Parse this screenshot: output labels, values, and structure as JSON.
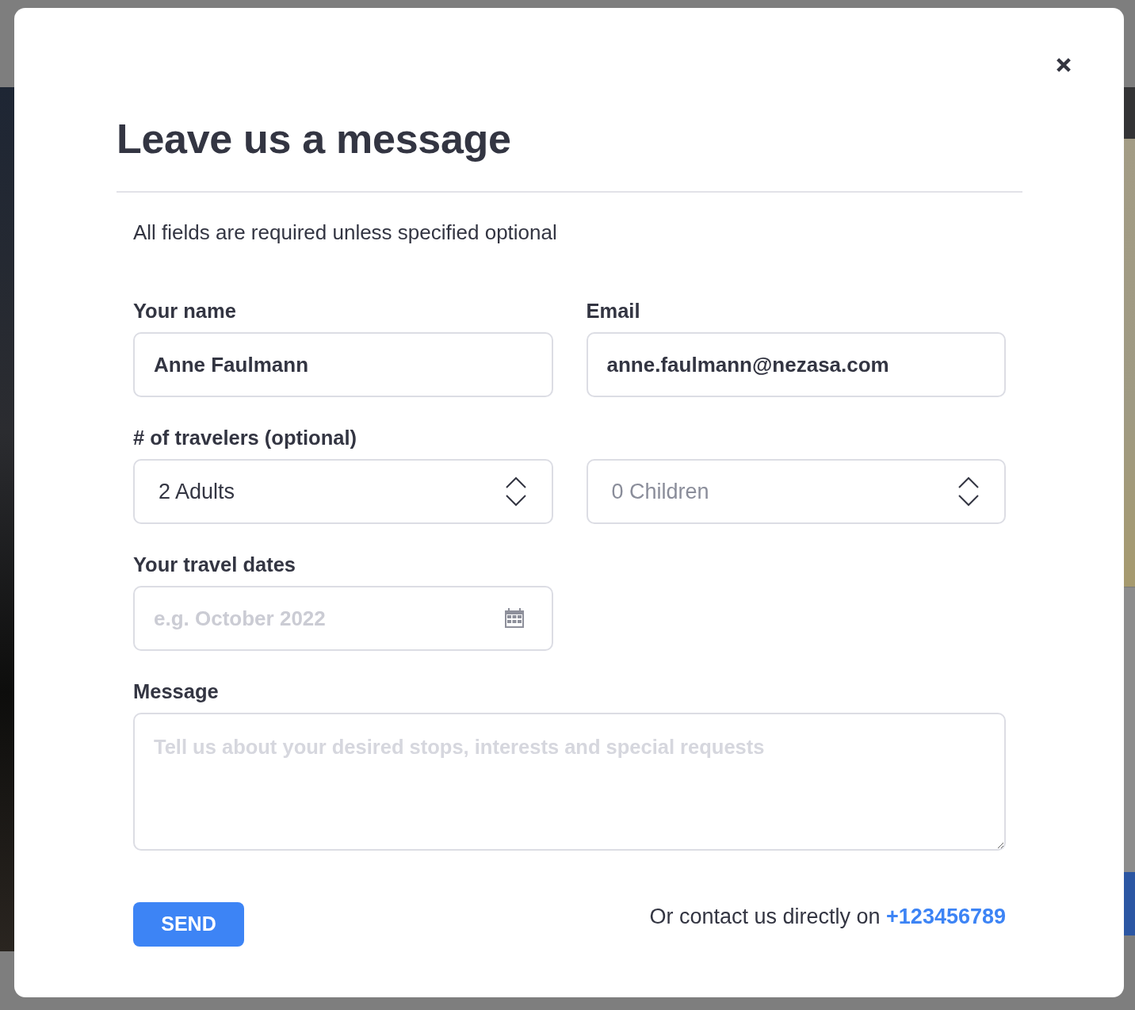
{
  "dialog": {
    "title": "Leave us a message",
    "note": "All fields are required unless specified optional"
  },
  "fields": [
    {
      "label": "Your name",
      "value": "Anne Faulmann"
    },
    {
      "label": "Email",
      "value": "anne.faulmann@nezasa.com"
    }
  ],
  "travelers": {
    "label": "# of travelers (optional)",
    "selects": [
      {
        "value": "2 Adults",
        "dimmed": false
      },
      {
        "value": "0 Children",
        "dimmed": true
      }
    ]
  },
  "travel_dates": {
    "label": "Your travel dates",
    "placeholder": "e.g. October 2022"
  },
  "message": {
    "label": "Message",
    "placeholder": "Tell us about your desired stops, interests and special requests"
  },
  "send_button": {
    "label": "SEND"
  },
  "contact": {
    "text": "Or contact us directly on",
    "link": "+123456789"
  }
}
